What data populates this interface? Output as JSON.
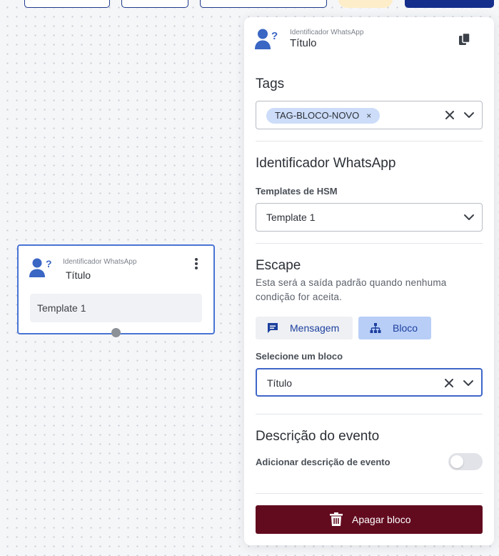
{
  "toolbar": {
    "icons": [
      "trash-icon",
      "save-icon"
    ]
  },
  "canvas_node": {
    "type_label": "Identificador WhatsApp",
    "title": "Título",
    "template": "Template 1",
    "icons": [
      "user-question-icon",
      "more-vertical-icon"
    ]
  },
  "panel": {
    "header": {
      "type_label": "Identificador WhatsApp",
      "title": "Título",
      "icons": [
        "user-question-icon",
        "copy-icon"
      ]
    },
    "tags": {
      "heading": "Tags",
      "chips": [
        {
          "label": "TAG-BLOCO-NOVO",
          "remove": "×"
        }
      ]
    },
    "identifier": {
      "heading": "Identificador WhatsApp",
      "templates_label": "Templates de HSM",
      "templates_value": "Template 1"
    },
    "escape": {
      "heading": "Escape",
      "description": "Esta será a saída padrão quando nenhuma condição for aceita.",
      "options": [
        {
          "label": "Mensagem",
          "icon": "message-icon",
          "selected": false
        },
        {
          "label": "Bloco",
          "icon": "sitemap-icon",
          "selected": true
        }
      ],
      "block_label": "Selecione um bloco",
      "block_value": "Título"
    },
    "event": {
      "heading": "Descrição do evento",
      "toggle_label": "Adicionar descrição de evento",
      "toggle_on": false
    },
    "delete_label": "Apagar bloco"
  },
  "colors": {
    "accent_blue": "#3f66c9",
    "icon_blue": "#3a66c4",
    "selected_option": "#b8cef7",
    "danger": "#620b1f",
    "toolbar_primary": "#142e8c"
  }
}
